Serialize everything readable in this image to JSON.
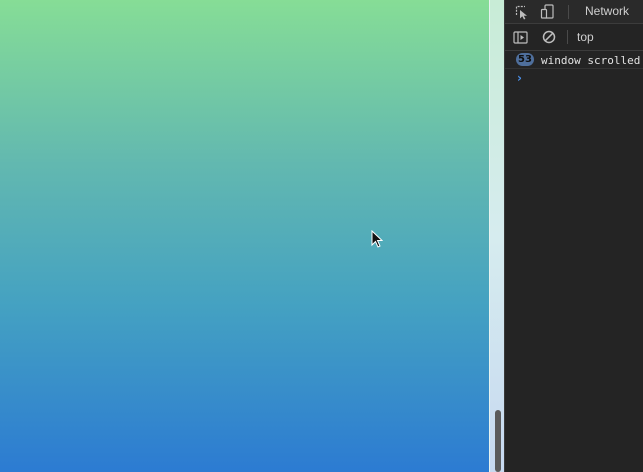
{
  "devtools": {
    "toolbar": {
      "inspect_icon": "inspect-element-icon",
      "device_icon": "device-toolbar-icon",
      "active_tab": "Network"
    },
    "console_bar": {
      "sidebar_icon": "console-sidebar-icon",
      "clear_icon": "clear-console-icon",
      "context": "top"
    },
    "console": {
      "messages": [
        {
          "repeat_count": "53",
          "text": "window scrolled"
        }
      ],
      "prompt_symbol": "›"
    }
  },
  "page": {
    "gradient_colors": [
      "#86dd96",
      "#62b8b0",
      "#44a1c2",
      "#2c7bd2"
    ]
  }
}
